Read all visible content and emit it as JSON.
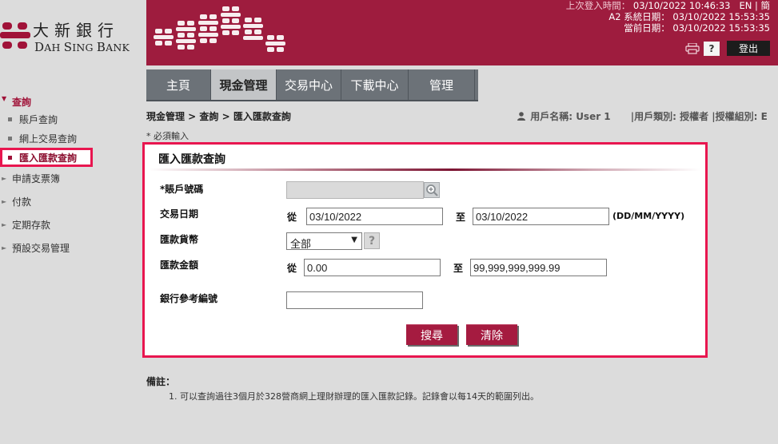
{
  "brand": {
    "name_cn": "大新銀行",
    "name_en_cap1": "D",
    "name_en_rest1": "AH ",
    "name_en_cap2": "S",
    "name_en_rest2": "ING ",
    "name_en_cap3": "B",
    "name_en_rest3": "ANK"
  },
  "header": {
    "last_login_label": "上次登入時間：",
    "last_login_value": "03/10/2022 10:46:33",
    "lang_en": "EN",
    "lang_sep": "|",
    "lang_cn": "簡",
    "a2_date_label": "A2 系統日期：",
    "a2_date_value": "03/10/2022 15:53:35",
    "current_date_label": "當前日期：",
    "current_date_value": "03/10/2022 15:53:35",
    "help_label": "?",
    "logout_label": "登出"
  },
  "topnav": {
    "tabs": [
      {
        "label": "主頁"
      },
      {
        "label": "現金管理"
      },
      {
        "label": "交易中心"
      },
      {
        "label": "下載中心"
      },
      {
        "label": "管理"
      }
    ]
  },
  "sidebar": {
    "query": "查詢",
    "sub_items": [
      {
        "label": "賬戶查詢"
      },
      {
        "label": "網上交易查詢"
      },
      {
        "label": "匯入匯款查詢"
      }
    ],
    "more_items": [
      {
        "label": "申請支票簿"
      },
      {
        "label": "付款"
      },
      {
        "label": "定期存款"
      },
      {
        "label": "預設交易管理"
      }
    ]
  },
  "breadcrumb": "現金管理 > 查詢 > 匯入匯款查詢",
  "user": {
    "username_label": "用戶名稱:",
    "username_value": "User 1",
    "category_text": "|用戶類別: 授權者 |授權組別: E"
  },
  "required_note": "* 必須輸入",
  "form": {
    "title": "匯入匯款查詢",
    "account_label": "*賬戶號碼",
    "account_value": "",
    "date_label": "交易日期",
    "from_label": "從",
    "to_label": "至",
    "date_from": "03/10/2022",
    "date_to": "03/10/2022",
    "date_format": "(DD/MM/YYYY)",
    "currency_label": "匯款貨幣",
    "currency_value": "全部",
    "currency_help": "?",
    "amount_label": "匯款金額",
    "amount_from": "0.00",
    "amount_to": "99,999,999,999.99",
    "ref_label": "銀行參考編號",
    "ref_value": "",
    "search_button": "搜尋",
    "clear_button": "清除"
  },
  "remarks": {
    "title": "備註：",
    "item": "1. 可以查詢過往3個月於328營商網上理財辦理的匯入匯款記錄。記錄會以每14天的範圍列出。"
  },
  "colors": {
    "brand": "#9e1c3e",
    "highlight": "#e8164f",
    "nav": "#6c7278"
  }
}
